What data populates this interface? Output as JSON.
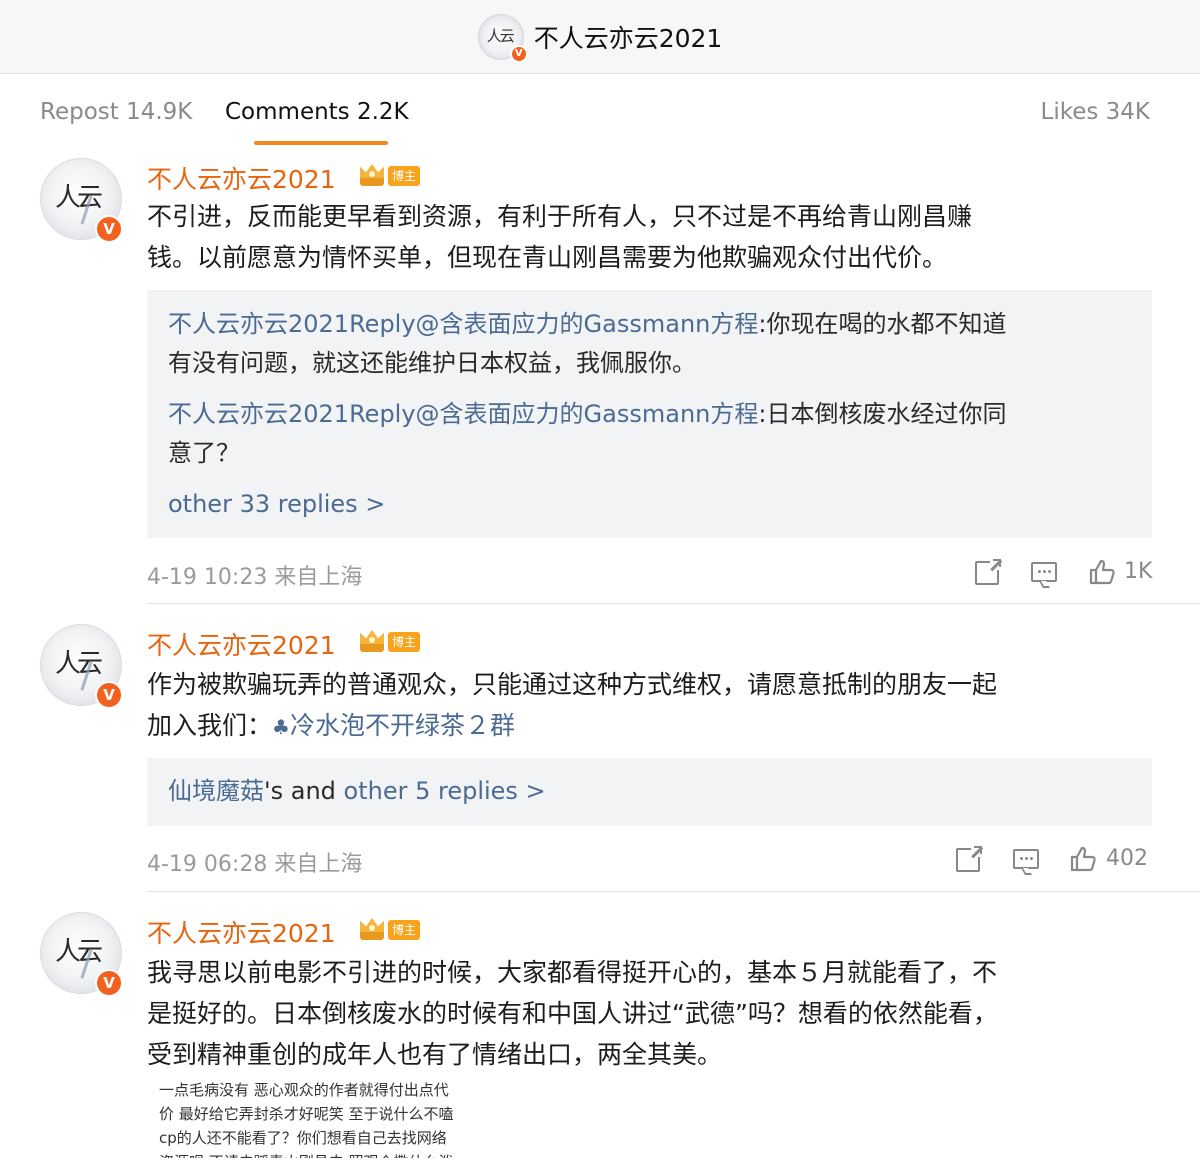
{
  "header": {
    "title": "不人云亦云2021",
    "avatar_icon": "user-avatar",
    "verified_badge": "V"
  },
  "tabs": {
    "repost": "Repost 14.9K",
    "comments": "Comments 2.2K",
    "likes": "Likes 34K"
  },
  "badge_text": "博主",
  "comments": [
    {
      "user": "不人云亦云2021",
      "text": [
        "不引进，反而能更早看到资源，有利于所有人，只不过是不再给青山刚昌赚",
        "钱。以前愿意为情怀买单，但现在青山刚昌需要为他欺骗观众付出代价。"
      ],
      "replies": [
        {
          "user": "不人云亦云2021",
          "reply_word": "Reply",
          "mention": "@含表面应力的Gassmann方程",
          "text_line1": ":你现在喝的水都不知道",
          "text_line2": "有没有问题，就这还能维护日本权益，我佩服你。"
        },
        {
          "user": "不人云亦云2021",
          "reply_word": "Reply",
          "mention": "@含表面应力的Gassmann方程",
          "text_line1": ":日本倒核废水经过你同",
          "text_line2": "意了？"
        }
      ],
      "more_replies": "other 33 replies >",
      "meta": "4-19 10:23 来自上海",
      "likes": "1K"
    },
    {
      "user": "不人云亦云2021",
      "text_line1": "作为被欺骗玩弄的普通观众，只能通过这种方式维权，请愿意抵制的朋友一起",
      "text_line2_prefix": "加入我们：",
      "group_link": "冷水泡不开绿茶２群",
      "reply_summary": {
        "user": "仙境魔菇",
        "middle": "'s and ",
        "more": "other 5 replies >"
      },
      "meta": "4-19 06:28 来自上海",
      "likes": "402"
    },
    {
      "user": "不人云亦云2021",
      "text": [
        "我寻思以前电影不引进的时候，大家都看得挺开心的，基本５月就能看了，不",
        "是挺好的。日本倒核废水的时候有和中国人讲过“武德”吗？想看的依然能看，",
        "受到精神重创的成年人也有了情绪出口，两全其美。"
      ],
      "attachment_lines": [
        "一点毛病没有  恶心观众的作者就得付出点代",
        "价 最好给它弄封杀才好呢笑  至于说什么不嗑",
        "cp的人还不能看了？你们想看自己去找网络",
        "资源呗  不请去踩青山刚昌去  照观众撒什么泼"
      ]
    }
  ],
  "colors": {
    "username": "#e8640f",
    "link": "#4b6b93",
    "accent": "#f28a1f",
    "reply_bg": "#f2f3f5"
  }
}
